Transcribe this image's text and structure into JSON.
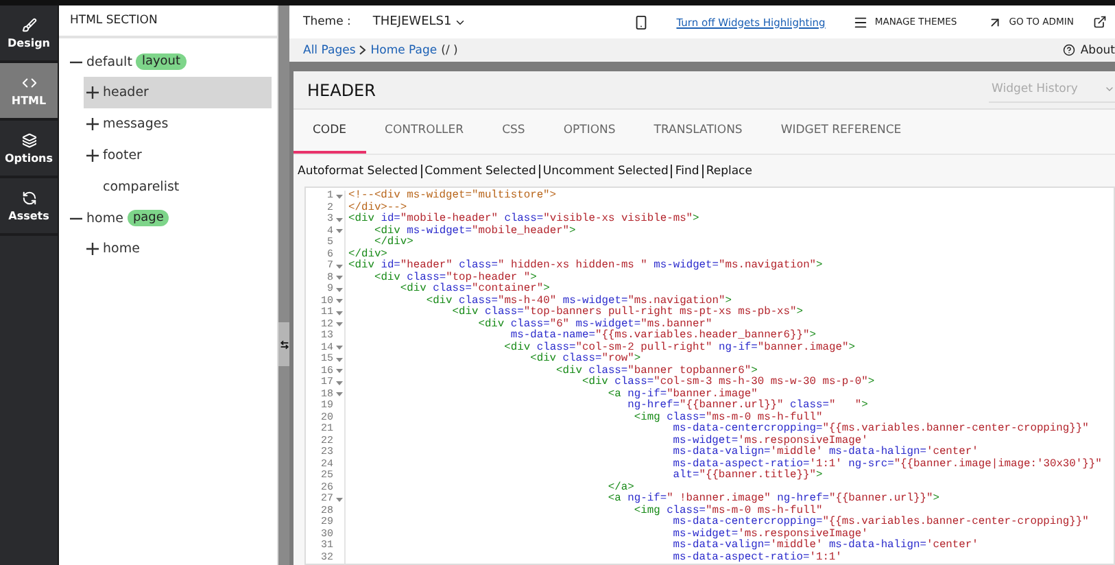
{
  "rail": [
    {
      "label": "Design",
      "selected": false
    },
    {
      "label": "HTML",
      "selected": true
    },
    {
      "label": "Options",
      "selected": false
    },
    {
      "label": "Assets",
      "selected": false
    }
  ],
  "sidebar": {
    "title": "HTML SECTION",
    "items": [
      {
        "label": "default",
        "badge": "layout",
        "expandable": true,
        "expanded": true,
        "selected": false,
        "children": [
          {
            "label": "header",
            "expandable": true,
            "expanded": false,
            "selected": true
          },
          {
            "label": "messages",
            "expandable": true,
            "expanded": false,
            "selected": false
          },
          {
            "label": "footer",
            "expandable": true,
            "expanded": false,
            "selected": false
          },
          {
            "label": "comparelist",
            "expandable": false,
            "selected": false
          }
        ]
      },
      {
        "label": "home",
        "badge": "page",
        "expandable": true,
        "expanded": true,
        "selected": false,
        "children": [
          {
            "label": "home",
            "expandable": true,
            "expanded": false,
            "selected": false
          }
        ]
      }
    ]
  },
  "topbar": {
    "theme_label": "Theme :",
    "theme": "THEJEWELS1",
    "highlight_link": "Turn off Widgets Highlighting",
    "manage_themes": "MANAGE THEMES",
    "go_to_admin": "GO TO ADMIN"
  },
  "breadcrumb": {
    "links": [
      "All Pages",
      "Home Page"
    ],
    "suffix": "(/ )",
    "help": "About"
  },
  "widget": {
    "title": "HEADER",
    "history_placeholder": "Widget History",
    "tabs": [
      {
        "label": "CODE",
        "selected": true
      },
      {
        "label": "CONTROLLER",
        "selected": false
      },
      {
        "label": "CSS",
        "selected": false
      },
      {
        "label": "OPTIONS",
        "selected": false
      },
      {
        "label": "TRANSLATIONS",
        "selected": false
      },
      {
        "label": "WIDGET REFERENCE",
        "selected": false
      }
    ],
    "actions": [
      "Autoformat Selected",
      "Comment Selected",
      "Uncomment Selected",
      "Find",
      "Replace"
    ],
    "code": [
      {
        "number": "1",
        "foldable": true,
        "text": "<!--<div ms-widget=\"multistore\">"
      },
      {
        "number": "2",
        "foldable": false,
        "text": "</div>-->"
      },
      {
        "number": "3",
        "foldable": true,
        "text": "<div id=\"mobile-header\" class=\"visible-xs visible-ms\">"
      },
      {
        "number": "4",
        "foldable": true,
        "text": "    <div ms-widget=\"mobile_header\">"
      },
      {
        "number": "5",
        "foldable": false,
        "text": "    </div>"
      },
      {
        "number": "6",
        "foldable": false,
        "text": "</div>"
      },
      {
        "number": "7",
        "foldable": true,
        "text": "<div id=\"header\" class=\" hidden-xs hidden-ms \" ms-widget=\"ms.navigation\">"
      },
      {
        "number": "8",
        "foldable": true,
        "text": "    <div class=\"top-header \">"
      },
      {
        "number": "9",
        "foldable": true,
        "text": "        <div class=\"container\">"
      },
      {
        "number": "10",
        "foldable": true,
        "text": "            <div class=\"ms-h-40\" ms-widget=\"ms.navigation\">"
      },
      {
        "number": "11",
        "foldable": true,
        "text": "                <div class=\"top-banners pull-right ms-pt-xs ms-pb-xs\">"
      },
      {
        "number": "12",
        "foldable": true,
        "text": "                    <div class=\"6\" ms-widget=\"ms.banner\""
      },
      {
        "number": "13",
        "foldable": false,
        "text": "                         ms-data-name=\"{{ms.variables.header_banner6}}\">"
      },
      {
        "number": "14",
        "foldable": true,
        "text": "                        <div class=\"col-sm-2 pull-right\" ng-if=\"banner.image\">"
      },
      {
        "number": "15",
        "foldable": true,
        "text": "                            <div class=\"row\">"
      },
      {
        "number": "16",
        "foldable": true,
        "text": "                                <div class=\"banner topbanner6\">"
      },
      {
        "number": "17",
        "foldable": true,
        "text": "                                    <div class=\"col-sm-3 ms-h-30 ms-w-30 ms-p-0\">"
      },
      {
        "number": "18",
        "foldable": true,
        "text": "                                        <a ng-if=\"banner.image\""
      },
      {
        "number": "19",
        "foldable": false,
        "text": "                                           ng-href=\"{{banner.url}}\" class=\"   \">"
      },
      {
        "number": "20",
        "foldable": false,
        "text": "                                            <img class=\"ms-m-0 ms-h-full\""
      },
      {
        "number": "21",
        "foldable": false,
        "text": "                                                  ms-data-centercropping=\"{{ms.variables.banner-center-cropping}}\""
      },
      {
        "number": "22",
        "foldable": false,
        "text": "                                                  ms-widget='ms.responsiveImage'"
      },
      {
        "number": "23",
        "foldable": false,
        "text": "                                                  ms-data-valign='middle' ms-data-halign='center'"
      },
      {
        "number": "24",
        "foldable": false,
        "text": "                                                  ms-data-aspect-ratio='1:1' ng-src=\"{{banner.image|image:'30x30'}}\""
      },
      {
        "number": "25",
        "foldable": false,
        "text": "                                                  alt=\"{{banner.title}}\">"
      },
      {
        "number": "26",
        "foldable": false,
        "text": "                                        </a>"
      },
      {
        "number": "27",
        "foldable": true,
        "text": "                                        <a ng-if=\" !banner.image\" ng-href=\"{{banner.url}}\">"
      },
      {
        "number": "28",
        "foldable": false,
        "text": "                                            <img class=\"ms-m-0 ms-h-full\""
      },
      {
        "number": "29",
        "foldable": false,
        "text": "                                                  ms-data-centercropping=\"{{ms.variables.banner-center-cropping}}\""
      },
      {
        "number": "30",
        "foldable": false,
        "text": "                                                  ms-widget='ms.responsiveImage'"
      },
      {
        "number": "31",
        "foldable": false,
        "text": "                                                  ms-data-valign='middle' ms-data-halign='center'"
      },
      {
        "number": "32",
        "foldable": false,
        "text": "                                                  ms-data-aspect-ratio='1:1'"
      }
    ]
  }
}
